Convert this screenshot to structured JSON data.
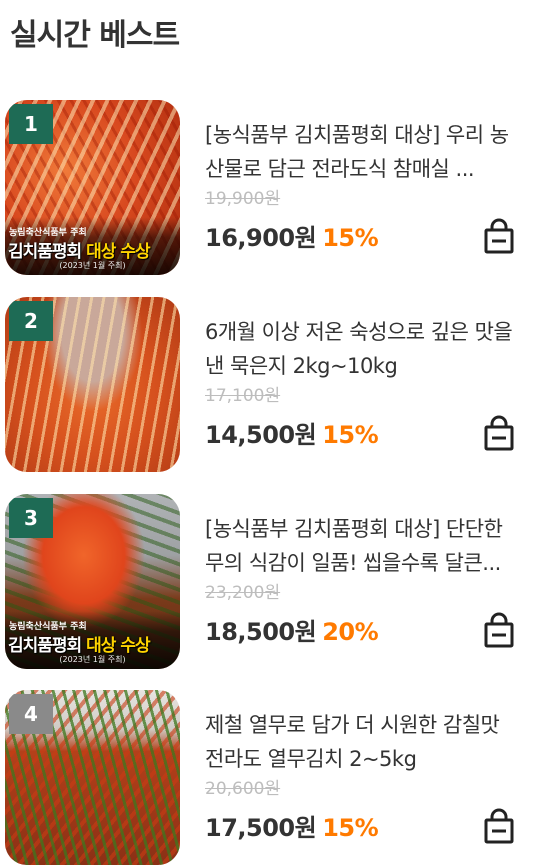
{
  "section_title": "실시간 베스트",
  "colors": {
    "discount": "#ff7a00",
    "rank_badge_top3": "#1e6b55",
    "rank_badge_other": "#8a8a8a",
    "strikethrough": "#bdbdbd"
  },
  "banner": {
    "sub": "농림축산식품부 주최",
    "main_prefix": "김치품평회 ",
    "main_highlight": "대상 수상",
    "date": "(2023년 1월 주최)"
  },
  "products": [
    {
      "rank": "1",
      "name": "[농식품부 김치품평회 대상] 우리 농산물로 담근 전라도식 참매실 ...",
      "original_price": "19,900원",
      "price": "16,900원",
      "discount": "15%",
      "has_banner": true,
      "image_icon": "kimchi-photo"
    },
    {
      "rank": "2",
      "name": "6개월 이상 저온 숙성으로 깊은 맛을 낸 묵은지 2kg~10kg",
      "original_price": "17,100원",
      "price": "14,500원",
      "discount": "15%",
      "has_banner": false,
      "image_icon": "aged-kimchi-photo"
    },
    {
      "rank": "3",
      "name": "[농식품부 김치품평회 대상] 단단한 무의 식감이 일품! 씹을수록 달큰...",
      "original_price": "23,200원",
      "price": "18,500원",
      "discount": "20%",
      "has_banner": true,
      "image_icon": "radish-kimchi-photo"
    },
    {
      "rank": "4",
      "name": "제철 열무로 담가 더 시원한 감칠맛 전라도 열무김치 2~5kg",
      "original_price": "20,600원",
      "price": "17,500원",
      "discount": "15%",
      "has_banner": false,
      "image_icon": "young-radish-kimchi-photo"
    }
  ]
}
